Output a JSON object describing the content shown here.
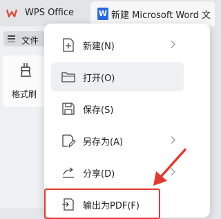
{
  "tabs": {
    "wps_label": "WPS Office",
    "doc_label": "新建 Microsoft Word 文"
  },
  "ribbon": {
    "file_label": "文件",
    "brush_label": "格式刷"
  },
  "menu": {
    "items": [
      {
        "label": "新建(N)",
        "icon": "new-doc-icon",
        "submenu": true
      },
      {
        "label": "打开(O)",
        "icon": "folder-icon",
        "submenu": false
      },
      {
        "label": "保存(S)",
        "icon": "save-icon",
        "submenu": false
      },
      {
        "label": "另存为(A)",
        "icon": "save-as-icon",
        "submenu": true
      },
      {
        "label": "分享(D)",
        "icon": "share-icon",
        "submenu": true
      },
      {
        "label": "输出为PDF(F)",
        "icon": "pdf-export-icon",
        "submenu": false
      }
    ]
  },
  "colors": {
    "wps_red": "#e8402f",
    "word_blue": "#2b6adf",
    "highlight_red": "#e43a2e"
  }
}
